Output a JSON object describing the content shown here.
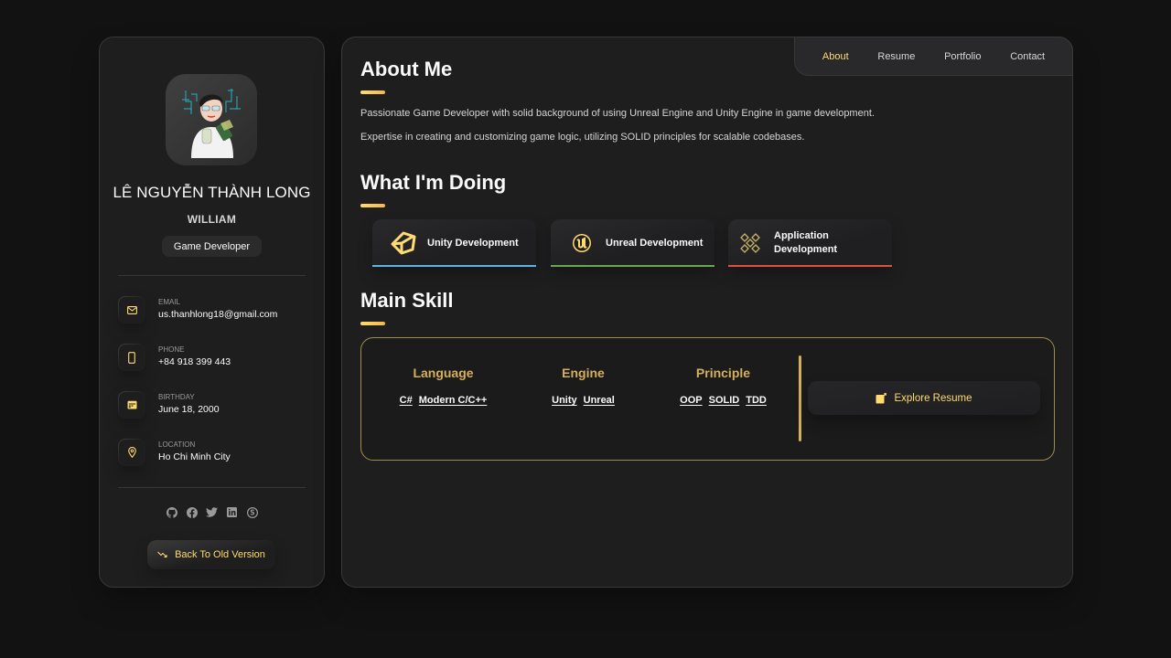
{
  "sidebar": {
    "name": "LÊ NGUYỄN THÀNH LONG",
    "nickname": "WILLIAM",
    "title": "Game Developer",
    "contacts": [
      {
        "icon": "mail-icon",
        "label": "EMAIL",
        "value": "us.thanhlong18@gmail.com"
      },
      {
        "icon": "phone-icon",
        "label": "PHONE",
        "value": "+84 918 399 443"
      },
      {
        "icon": "calendar-icon",
        "label": "BIRTHDAY",
        "value": "June 18, 2000"
      },
      {
        "icon": "location-icon",
        "label": "LOCATION",
        "value": "Ho Chi Minh City"
      }
    ],
    "social": [
      "github-icon",
      "facebook-icon",
      "twitter-icon",
      "linkedin-icon",
      "skype-icon"
    ],
    "old_version_label": "Back To Old Version"
  },
  "navbar": {
    "items": [
      {
        "label": "About",
        "active": true
      },
      {
        "label": "Resume",
        "active": false
      },
      {
        "label": "Portfolio",
        "active": false
      },
      {
        "label": "Contact",
        "active": false
      }
    ]
  },
  "about": {
    "title": "About Me",
    "paragraphs": [
      "Passionate Game Developer with solid background of using Unreal Engine and Unity Engine in game development.",
      "Expertise in creating and customizing game logic, utilizing SOLID principles for scalable codebases."
    ]
  },
  "doing": {
    "title": "What I'm Doing",
    "services": [
      {
        "label": "Unity Development",
        "icon": "unity-icon",
        "color": "#5bb6e6"
      },
      {
        "label": "Unreal Development",
        "icon": "unreal-icon",
        "color": "#6aa84f"
      },
      {
        "label": "Application Development",
        "icon": "application-icon",
        "color": "#d9533f"
      }
    ]
  },
  "skill": {
    "title": "Main Skill",
    "groups": [
      {
        "heading": "Language",
        "tags": [
          "C#",
          "Modern C/C++"
        ]
      },
      {
        "heading": "Engine",
        "tags": [
          "Unity",
          "Unreal"
        ]
      },
      {
        "heading": "Principle",
        "tags": [
          "OOP",
          "SOLID",
          "TDD"
        ]
      }
    ],
    "explore_label": "Explore Resume"
  },
  "colors": {
    "accent": "#ffdb70",
    "background": "#121212",
    "card": "#1e1e1f"
  }
}
